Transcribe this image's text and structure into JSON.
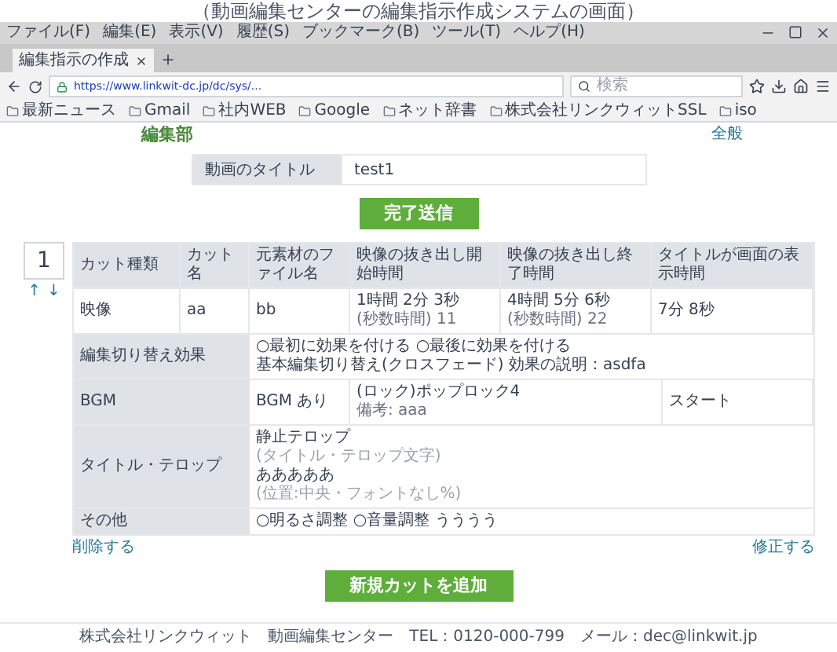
{
  "caption": "（動画編集センターの編集指示作成システムの画面）",
  "browser": {
    "menu": [
      "ファイル(F)",
      "編集(E)",
      "表示(V)",
      "履歴(S)",
      "ブックマーク(B)",
      "ツール(T)",
      "ヘルプ(H)"
    ],
    "tab": {
      "title": "編集指示の作成"
    },
    "url": "https://www.linkwit-dc.jp/dc/sys/...",
    "search": {
      "placeholder": "検索"
    },
    "bookmarks": [
      "最新ニュース",
      "Gmail",
      "社内WEB",
      "Google",
      "ネット辞書",
      "株式会社リンクウィットSSL",
      "iso"
    ]
  },
  "page": {
    "logo": "編集部",
    "top_link": "全般",
    "title_field": {
      "label": "動画のタイトル",
      "value": "test1"
    },
    "submit_button": "完了送信",
    "cut": {
      "number": "1",
      "move_up": "↑",
      "move_down": "↓",
      "columns": [
        "カット種類",
        "カット名",
        "元素材のファイル名",
        "映像の抜き出し開始時間",
        "映像の抜き出し終了時間",
        "タイトルが画面の表示時間"
      ],
      "row": [
        {
          "lines": [
            "映像"
          ]
        },
        {
          "lines": [
            "aa"
          ]
        },
        {
          "lines": [
            "bb"
          ]
        },
        {
          "lines": [
            "1時間 2分 3秒",
            "(秒数時間) 11"
          ]
        },
        {
          "lines": [
            "4時間 5分 6秒",
            "(秒数時間) 22"
          ]
        },
        {
          "lines": [
            "7分 8秒"
          ]
        }
      ],
      "sections": [
        {
          "kind": "text",
          "label": "編集切り替え効果",
          "lines": [
            {
              "text": "○最初に効果を付ける ○最後に効果を付ける",
              "muted": false
            },
            {
              "text": "基本編集切り替え(クロスフェード) 効果の説明：asdfa",
              "muted": false
            }
          ]
        },
        {
          "kind": "bgm",
          "label": "BGM",
          "cells": [
            {
              "lines": [
                "BGM あり"
              ]
            },
            {
              "lines": [
                "(ロック)ポップロック4",
                "備考: aaa"
              ]
            },
            {
              "lines": [
                "スタート"
              ]
            }
          ]
        },
        {
          "kind": "text",
          "label": "タイトル・テロップ",
          "lines": [
            {
              "text": "静止テロップ",
              "muted": false
            },
            {
              "text": "(タイトル・テロップ文字)",
              "muted": true
            },
            {
              "text": "あああああ",
              "muted": false
            },
            {
              "text": "(位置:中央・フォントなし%)",
              "muted": true
            }
          ]
        },
        {
          "kind": "text",
          "label": "その他",
          "lines": [
            {
              "text": "○明るさ調整 ○音量調整 うううう",
              "muted": false
            }
          ]
        }
      ],
      "delete_link": "削除する",
      "edit_link": "修正する"
    },
    "add_button": "新規カットを追加",
    "footer": "株式会社リンクウィット　動画編集センター　TEL：0120-000-799　メール：dec@linkwit.jp"
  }
}
